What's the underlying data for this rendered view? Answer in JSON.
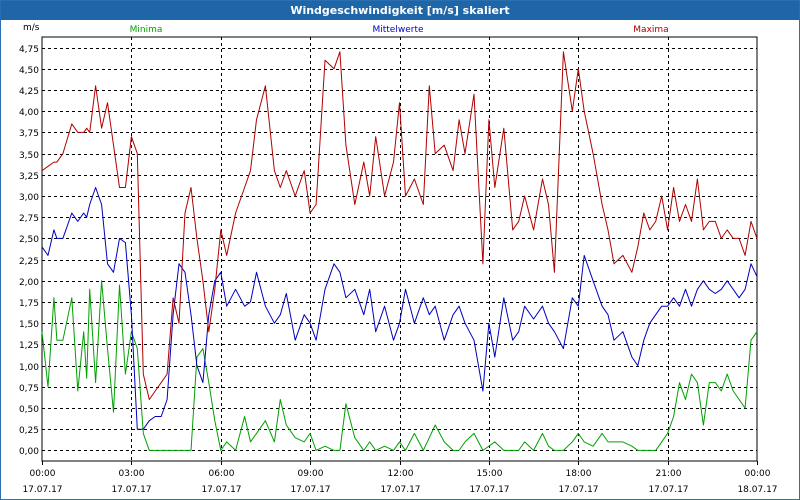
{
  "window": {
    "title": "Windgeschwindigkeit [m/s] skaliert"
  },
  "chart_data": {
    "type": "line",
    "title": "Windgeschwindigkeit [m/s] skaliert",
    "ylabel": "m/s",
    "ylim": [
      -0.125,
      4.875
    ],
    "xlim": [
      0,
      24
    ],
    "grid": true,
    "legend": "top",
    "y_ticks": [
      0,
      0.25,
      0.5,
      0.75,
      1,
      1.25,
      1.5,
      1.75,
      2,
      2.25,
      2.5,
      2.75,
      3,
      3.25,
      3.5,
      3.75,
      4,
      4.25,
      4.5,
      4.75
    ],
    "y_tick_labels": [
      "0,00",
      "0,25",
      "0,50",
      "0,75",
      "1,00",
      "1,25",
      "1,50",
      "1,75",
      "2,00",
      "2,25",
      "2,50",
      "2,75",
      "3,00",
      "3,25",
      "3,50",
      "3,75",
      "4,00",
      "4,25",
      "4,50",
      "4,75"
    ],
    "x_ticks": [
      0,
      3,
      6,
      9,
      12,
      15,
      18,
      21,
      24
    ],
    "x_tick_labels": [
      [
        "00:00",
        "17.07.17"
      ],
      [
        "03:00",
        "17.07.17"
      ],
      [
        "06:00",
        "17.07.17"
      ],
      [
        "09:00",
        "17.07.17"
      ],
      [
        "12:00",
        "17.07.17"
      ],
      [
        "15:00",
        "17.07.17"
      ],
      [
        "18:00",
        "17.07.17"
      ],
      [
        "21:00",
        "17.07.17"
      ],
      [
        "00:00",
        "18.07.17"
      ]
    ],
    "series": [
      {
        "name": "Minima",
        "color": "#00a000",
        "x": [
          0,
          0.2,
          0.4,
          0.5,
          0.7,
          1,
          1.2,
          1.4,
          1.5,
          1.6,
          1.8,
          2,
          2.2,
          2.4,
          2.6,
          2.8,
          3,
          3.2,
          3.4,
          3.6,
          3.8,
          4,
          4.2,
          4.4,
          4.6,
          4.8,
          5,
          5.2,
          5.4,
          5.6,
          5.8,
          6,
          6.2,
          6.5,
          6.8,
          7,
          7.2,
          7.5,
          7.8,
          8,
          8.2,
          8.5,
          8.8,
          9,
          9.2,
          9.5,
          9.8,
          10,
          10.2,
          10.5,
          10.8,
          11,
          11.2,
          11.5,
          11.8,
          12,
          12.2,
          12.5,
          12.8,
          13,
          13.2,
          13.5,
          13.8,
          14,
          14.2,
          14.5,
          14.8,
          15,
          15.2,
          15.5,
          15.8,
          16,
          16.2,
          16.5,
          16.8,
          17,
          17.2,
          17.5,
          17.8,
          18,
          18.2,
          18.5,
          18.8,
          19,
          19.2,
          19.5,
          19.8,
          20,
          20.2,
          20.4,
          20.6,
          20.8,
          21,
          21.2,
          21.4,
          21.6,
          21.8,
          22,
          22.2,
          22.4,
          22.6,
          22.8,
          23,
          23.2,
          23.4,
          23.6,
          23.8,
          24
        ],
        "y": [
          1.4,
          0.75,
          1.8,
          1.3,
          1.3,
          1.8,
          0.7,
          1.4,
          0.85,
          1.9,
          0.8,
          2,
          1.2,
          0.45,
          1.95,
          0.9,
          1.4,
          1.2,
          0.2,
          0,
          0,
          0,
          0,
          0,
          0,
          0,
          0,
          1.1,
          1.2,
          0.8,
          0.35,
          0,
          0.1,
          0,
          0.4,
          0.1,
          0.2,
          0.35,
          0.1,
          0.6,
          0.3,
          0.15,
          0.1,
          0.2,
          0,
          0.05,
          0,
          0,
          0.55,
          0.15,
          0,
          0.1,
          0,
          0.05,
          0,
          0.1,
          0,
          0.2,
          0,
          0.15,
          0.3,
          0.1,
          0,
          0,
          0.1,
          0.2,
          0,
          0.05,
          0.1,
          0,
          0,
          0,
          0.1,
          0,
          0.2,
          0.05,
          0,
          0,
          0.1,
          0.2,
          0.1,
          0.05,
          0.2,
          0.1,
          0.1,
          0.1,
          0.05,
          0,
          0,
          0,
          0,
          0.1,
          0.2,
          0.4,
          0.8,
          0.6,
          0.9,
          0.8,
          0.3,
          0.8,
          0.8,
          0.7,
          0.9,
          0.7,
          0.6,
          0.5,
          1.3,
          1.4
        ]
      },
      {
        "name": "Mittelwerte",
        "color": "#0000c0",
        "x": [
          0,
          0.2,
          0.4,
          0.5,
          0.7,
          1,
          1.2,
          1.4,
          1.5,
          1.6,
          1.8,
          2,
          2.2,
          2.4,
          2.6,
          2.8,
          3,
          3.2,
          3.4,
          3.6,
          3.8,
          4,
          4.2,
          4.4,
          4.6,
          4.8,
          5,
          5.2,
          5.4,
          5.6,
          5.8,
          6,
          6.2,
          6.5,
          6.8,
          7,
          7.2,
          7.5,
          7.8,
          8,
          8.2,
          8.5,
          8.8,
          9,
          9.2,
          9.5,
          9.8,
          10,
          10.2,
          10.5,
          10.8,
          11,
          11.2,
          11.5,
          11.8,
          12,
          12.2,
          12.5,
          12.8,
          13,
          13.2,
          13.5,
          13.8,
          14,
          14.2,
          14.5,
          14.8,
          15,
          15.2,
          15.5,
          15.8,
          16,
          16.2,
          16.5,
          16.8,
          17,
          17.2,
          17.5,
          17.8,
          18,
          18.2,
          18.5,
          18.8,
          19,
          19.2,
          19.5,
          19.8,
          20,
          20.2,
          20.4,
          20.6,
          20.8,
          21,
          21.2,
          21.4,
          21.6,
          21.8,
          22,
          22.2,
          22.4,
          22.6,
          22.8,
          23,
          23.2,
          23.4,
          23.6,
          23.8,
          24
        ],
        "y": [
          2.4,
          2.3,
          2.6,
          2.5,
          2.5,
          2.8,
          2.7,
          2.8,
          2.75,
          2.9,
          3.1,
          2.9,
          2.2,
          2.1,
          2.5,
          2.45,
          1.6,
          0.25,
          0.25,
          0.35,
          0.4,
          0.4,
          0.6,
          1.6,
          2.2,
          2.1,
          1.6,
          1,
          0.8,
          1.6,
          2,
          2.1,
          1.7,
          1.9,
          1.7,
          1.75,
          2.1,
          1.7,
          1.5,
          1.6,
          1.85,
          1.3,
          1.6,
          1.5,
          1.3,
          1.9,
          2.2,
          2.1,
          1.8,
          1.9,
          1.6,
          1.9,
          1.4,
          1.7,
          1.3,
          1.5,
          1.9,
          1.5,
          1.8,
          1.6,
          1.7,
          1.3,
          1.6,
          1.7,
          1.5,
          1.3,
          0.7,
          1.5,
          1.1,
          1.8,
          1.3,
          1.4,
          1.7,
          1.55,
          1.7,
          1.5,
          1.4,
          1.2,
          1.8,
          1.7,
          2.3,
          2,
          1.7,
          1.6,
          1.3,
          1.4,
          1.1,
          1,
          1.3,
          1.5,
          1.6,
          1.7,
          1.7,
          1.8,
          1.7,
          1.9,
          1.7,
          1.9,
          2,
          1.9,
          1.85,
          1.9,
          2,
          1.9,
          1.8,
          1.9,
          2.2,
          2.05
        ]
      },
      {
        "name": "Maxima",
        "color": "#b00000",
        "x": [
          0,
          0.2,
          0.4,
          0.5,
          0.7,
          1,
          1.2,
          1.4,
          1.5,
          1.6,
          1.8,
          2,
          2.2,
          2.4,
          2.6,
          2.8,
          3,
          3.2,
          3.4,
          3.6,
          3.8,
          4,
          4.2,
          4.4,
          4.6,
          4.8,
          5,
          5.2,
          5.4,
          5.6,
          5.8,
          6,
          6.2,
          6.5,
          6.8,
          7,
          7.2,
          7.5,
          7.8,
          8,
          8.2,
          8.5,
          8.8,
          9,
          9.2,
          9.5,
          9.8,
          10,
          10.2,
          10.5,
          10.8,
          11,
          11.2,
          11.5,
          11.8,
          12,
          12.2,
          12.5,
          12.8,
          13,
          13.2,
          13.5,
          13.8,
          14,
          14.2,
          14.5,
          14.8,
          15,
          15.2,
          15.5,
          15.8,
          16,
          16.2,
          16.5,
          16.8,
          17,
          17.2,
          17.5,
          17.8,
          18,
          18.2,
          18.5,
          18.8,
          19,
          19.2,
          19.5,
          19.8,
          20,
          20.2,
          20.4,
          20.6,
          20.8,
          21,
          21.2,
          21.4,
          21.6,
          21.8,
          22,
          22.2,
          22.4,
          22.6,
          22.8,
          23,
          23.2,
          23.4,
          23.6,
          23.8,
          24
        ],
        "y": [
          3.3,
          3.35,
          3.4,
          3.4,
          3.5,
          3.85,
          3.75,
          3.75,
          3.8,
          3.75,
          4.3,
          3.8,
          4.1,
          3.6,
          3.1,
          3.1,
          3.7,
          3.5,
          0.9,
          0.6,
          0.7,
          0.8,
          0.9,
          1.8,
          1.5,
          2.8,
          3.1,
          2.5,
          2,
          1.4,
          1.9,
          2.6,
          2.3,
          2.8,
          3.1,
          3.3,
          3.9,
          4.3,
          3.3,
          3.1,
          3.3,
          3,
          3.3,
          2.8,
          2.9,
          4.6,
          4.5,
          4.7,
          3.6,
          2.9,
          3.4,
          3,
          3.7,
          3,
          3.4,
          4.1,
          3,
          3.2,
          2.9,
          4.3,
          3.5,
          3.6,
          3.3,
          3.9,
          3.5,
          4.2,
          2.2,
          3.9,
          3.1,
          3.8,
          2.6,
          2.7,
          3,
          2.6,
          3.2,
          2.9,
          2.1,
          4.7,
          4,
          4.5,
          4,
          3.5,
          2.9,
          2.6,
          2.2,
          2.3,
          2.1,
          2.4,
          2.8,
          2.6,
          2.7,
          3,
          2.6,
          3.1,
          2.7,
          2.9,
          2.7,
          3.2,
          2.6,
          2.7,
          2.7,
          2.5,
          2.6,
          2.5,
          2.5,
          2.3,
          2.7,
          2.5
        ]
      }
    ]
  }
}
